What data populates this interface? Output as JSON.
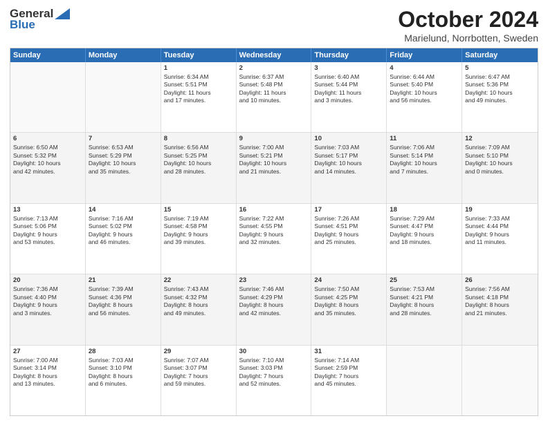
{
  "header": {
    "logo_general": "General",
    "logo_blue": "Blue",
    "title": "October 2024",
    "location": "Marielund, Norrbotten, Sweden"
  },
  "days_of_week": [
    "Sunday",
    "Monday",
    "Tuesday",
    "Wednesday",
    "Thursday",
    "Friday",
    "Saturday"
  ],
  "rows": [
    [
      {
        "day": "",
        "lines": [],
        "empty": true
      },
      {
        "day": "",
        "lines": [],
        "empty": true
      },
      {
        "day": "1",
        "lines": [
          "Sunrise: 6:34 AM",
          "Sunset: 5:51 PM",
          "Daylight: 11 hours",
          "and 17 minutes."
        ]
      },
      {
        "day": "2",
        "lines": [
          "Sunrise: 6:37 AM",
          "Sunset: 5:48 PM",
          "Daylight: 11 hours",
          "and 10 minutes."
        ]
      },
      {
        "day": "3",
        "lines": [
          "Sunrise: 6:40 AM",
          "Sunset: 5:44 PM",
          "Daylight: 11 hours",
          "and 3 minutes."
        ]
      },
      {
        "day": "4",
        "lines": [
          "Sunrise: 6:44 AM",
          "Sunset: 5:40 PM",
          "Daylight: 10 hours",
          "and 56 minutes."
        ]
      },
      {
        "day": "5",
        "lines": [
          "Sunrise: 6:47 AM",
          "Sunset: 5:36 PM",
          "Daylight: 10 hours",
          "and 49 minutes."
        ]
      }
    ],
    [
      {
        "day": "6",
        "lines": [
          "Sunrise: 6:50 AM",
          "Sunset: 5:32 PM",
          "Daylight: 10 hours",
          "and 42 minutes."
        ]
      },
      {
        "day": "7",
        "lines": [
          "Sunrise: 6:53 AM",
          "Sunset: 5:29 PM",
          "Daylight: 10 hours",
          "and 35 minutes."
        ]
      },
      {
        "day": "8",
        "lines": [
          "Sunrise: 6:56 AM",
          "Sunset: 5:25 PM",
          "Daylight: 10 hours",
          "and 28 minutes."
        ]
      },
      {
        "day": "9",
        "lines": [
          "Sunrise: 7:00 AM",
          "Sunset: 5:21 PM",
          "Daylight: 10 hours",
          "and 21 minutes."
        ]
      },
      {
        "day": "10",
        "lines": [
          "Sunrise: 7:03 AM",
          "Sunset: 5:17 PM",
          "Daylight: 10 hours",
          "and 14 minutes."
        ]
      },
      {
        "day": "11",
        "lines": [
          "Sunrise: 7:06 AM",
          "Sunset: 5:14 PM",
          "Daylight: 10 hours",
          "and 7 minutes."
        ]
      },
      {
        "day": "12",
        "lines": [
          "Sunrise: 7:09 AM",
          "Sunset: 5:10 PM",
          "Daylight: 10 hours",
          "and 0 minutes."
        ]
      }
    ],
    [
      {
        "day": "13",
        "lines": [
          "Sunrise: 7:13 AM",
          "Sunset: 5:06 PM",
          "Daylight: 9 hours",
          "and 53 minutes."
        ]
      },
      {
        "day": "14",
        "lines": [
          "Sunrise: 7:16 AM",
          "Sunset: 5:02 PM",
          "Daylight: 9 hours",
          "and 46 minutes."
        ]
      },
      {
        "day": "15",
        "lines": [
          "Sunrise: 7:19 AM",
          "Sunset: 4:58 PM",
          "Daylight: 9 hours",
          "and 39 minutes."
        ]
      },
      {
        "day": "16",
        "lines": [
          "Sunrise: 7:22 AM",
          "Sunset: 4:55 PM",
          "Daylight: 9 hours",
          "and 32 minutes."
        ]
      },
      {
        "day": "17",
        "lines": [
          "Sunrise: 7:26 AM",
          "Sunset: 4:51 PM",
          "Daylight: 9 hours",
          "and 25 minutes."
        ]
      },
      {
        "day": "18",
        "lines": [
          "Sunrise: 7:29 AM",
          "Sunset: 4:47 PM",
          "Daylight: 9 hours",
          "and 18 minutes."
        ]
      },
      {
        "day": "19",
        "lines": [
          "Sunrise: 7:33 AM",
          "Sunset: 4:44 PM",
          "Daylight: 9 hours",
          "and 11 minutes."
        ]
      }
    ],
    [
      {
        "day": "20",
        "lines": [
          "Sunrise: 7:36 AM",
          "Sunset: 4:40 PM",
          "Daylight: 9 hours",
          "and 3 minutes."
        ]
      },
      {
        "day": "21",
        "lines": [
          "Sunrise: 7:39 AM",
          "Sunset: 4:36 PM",
          "Daylight: 8 hours",
          "and 56 minutes."
        ]
      },
      {
        "day": "22",
        "lines": [
          "Sunrise: 7:43 AM",
          "Sunset: 4:32 PM",
          "Daylight: 8 hours",
          "and 49 minutes."
        ]
      },
      {
        "day": "23",
        "lines": [
          "Sunrise: 7:46 AM",
          "Sunset: 4:29 PM",
          "Daylight: 8 hours",
          "and 42 minutes."
        ]
      },
      {
        "day": "24",
        "lines": [
          "Sunrise: 7:50 AM",
          "Sunset: 4:25 PM",
          "Daylight: 8 hours",
          "and 35 minutes."
        ]
      },
      {
        "day": "25",
        "lines": [
          "Sunrise: 7:53 AM",
          "Sunset: 4:21 PM",
          "Daylight: 8 hours",
          "and 28 minutes."
        ]
      },
      {
        "day": "26",
        "lines": [
          "Sunrise: 7:56 AM",
          "Sunset: 4:18 PM",
          "Daylight: 8 hours",
          "and 21 minutes."
        ]
      }
    ],
    [
      {
        "day": "27",
        "lines": [
          "Sunrise: 7:00 AM",
          "Sunset: 3:14 PM",
          "Daylight: 8 hours",
          "and 13 minutes."
        ]
      },
      {
        "day": "28",
        "lines": [
          "Sunrise: 7:03 AM",
          "Sunset: 3:10 PM",
          "Daylight: 8 hours",
          "and 6 minutes."
        ]
      },
      {
        "day": "29",
        "lines": [
          "Sunrise: 7:07 AM",
          "Sunset: 3:07 PM",
          "Daylight: 7 hours",
          "and 59 minutes."
        ]
      },
      {
        "day": "30",
        "lines": [
          "Sunrise: 7:10 AM",
          "Sunset: 3:03 PM",
          "Daylight: 7 hours",
          "and 52 minutes."
        ]
      },
      {
        "day": "31",
        "lines": [
          "Sunrise: 7:14 AM",
          "Sunset: 2:59 PM",
          "Daylight: 7 hours",
          "and 45 minutes."
        ]
      },
      {
        "day": "",
        "lines": [],
        "empty": true
      },
      {
        "day": "",
        "lines": [],
        "empty": true
      }
    ]
  ]
}
